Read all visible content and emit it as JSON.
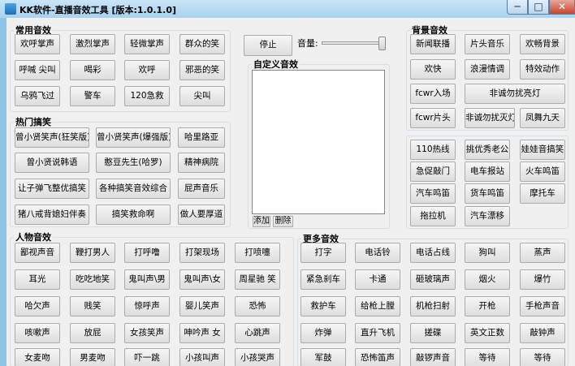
{
  "window": {
    "title": "KK软件-直播音效工具 [版本:1.0.1.0]",
    "min": "─",
    "max": "□",
    "close": "✕"
  },
  "groups": {
    "common": "常用音效",
    "hot": "热门搞笑",
    "people": "人物音效",
    "custom": "自定义音效",
    "bg": "背景音效",
    "more": "更多音效"
  },
  "common": [
    "欢呼掌声",
    "激烈掌声",
    "轻微掌声",
    "群众的笑",
    "呼喊 尖叫",
    "喝彩",
    "欢呼",
    "邪恶的笑",
    "乌鸦飞过",
    "警车",
    "120急救",
    "尖叫"
  ],
  "hot": [
    "曾小贤笑声(狂笑版)",
    "曾小贤笑声(爆强版)",
    "哈里路亚",
    "曾小贤说韩语",
    "憨豆先生(哈罗)",
    "精神病院",
    "让子弹飞整优搞笑",
    "各种搞笑音效综合",
    "屁声音乐",
    "猪八戒背媳妇伴奏",
    "搞笑救命啊",
    "做人要厚道"
  ],
  "people": [
    "鄙视声音",
    "鞭打男人",
    "打呼噜",
    "打架现场",
    "打喷嚏",
    "耳光",
    "吃吃地笑",
    "鬼叫声\\男",
    "鬼叫声\\女",
    "周星驰 笑",
    "哈欠声",
    "贱笑",
    "惊呼声",
    "婴儿笑声",
    "恐怖",
    "咳嗽声",
    "放屁",
    "女孩笑声",
    "呻吟声 女",
    "心跳声",
    "女麦吻",
    "男麦吻",
    "吓一跳",
    "小孩叫声",
    "小孩哭声"
  ],
  "controls": {
    "stop": "停止",
    "volume_label": "音量:",
    "add": "添加",
    "delete": "删除"
  },
  "volume_level": 1.0,
  "bg": {
    "row1": [
      "新闻联播",
      "片头音乐",
      "欢畅背景"
    ],
    "row2": [
      "欢快",
      "浪漫情调",
      "特效动作"
    ],
    "row3": [
      "fcwr入场",
      "非诚勿扰亮灯"
    ],
    "row4": [
      "fcwr片头",
      "非诚勿扰灭灯",
      "凤舞九天"
    ]
  },
  "extra": [
    "110热线",
    "挑优秀老公",
    "娃娃音搞笑",
    "急促敲门",
    "电车报站",
    "火车鸣笛",
    "汽车鸣笛",
    "货车鸣笛",
    "摩托车",
    "拖拉机",
    "汽车漂移"
  ],
  "more": [
    "打字",
    "电话铃",
    "电话占线",
    "狗叫",
    "蒸声",
    "紧急刹车",
    "卡通",
    "砸玻璃声",
    "烟火",
    "爆竹",
    "救护车",
    "给枪上膛",
    "机枪扫射",
    "开枪",
    "手枪声音",
    "炸弹",
    "直升飞机",
    "搓碟",
    "英文正数",
    "敲钟声",
    "军鼓",
    "恐怖笛声",
    "敲锣声音",
    "等待",
    "等待"
  ]
}
